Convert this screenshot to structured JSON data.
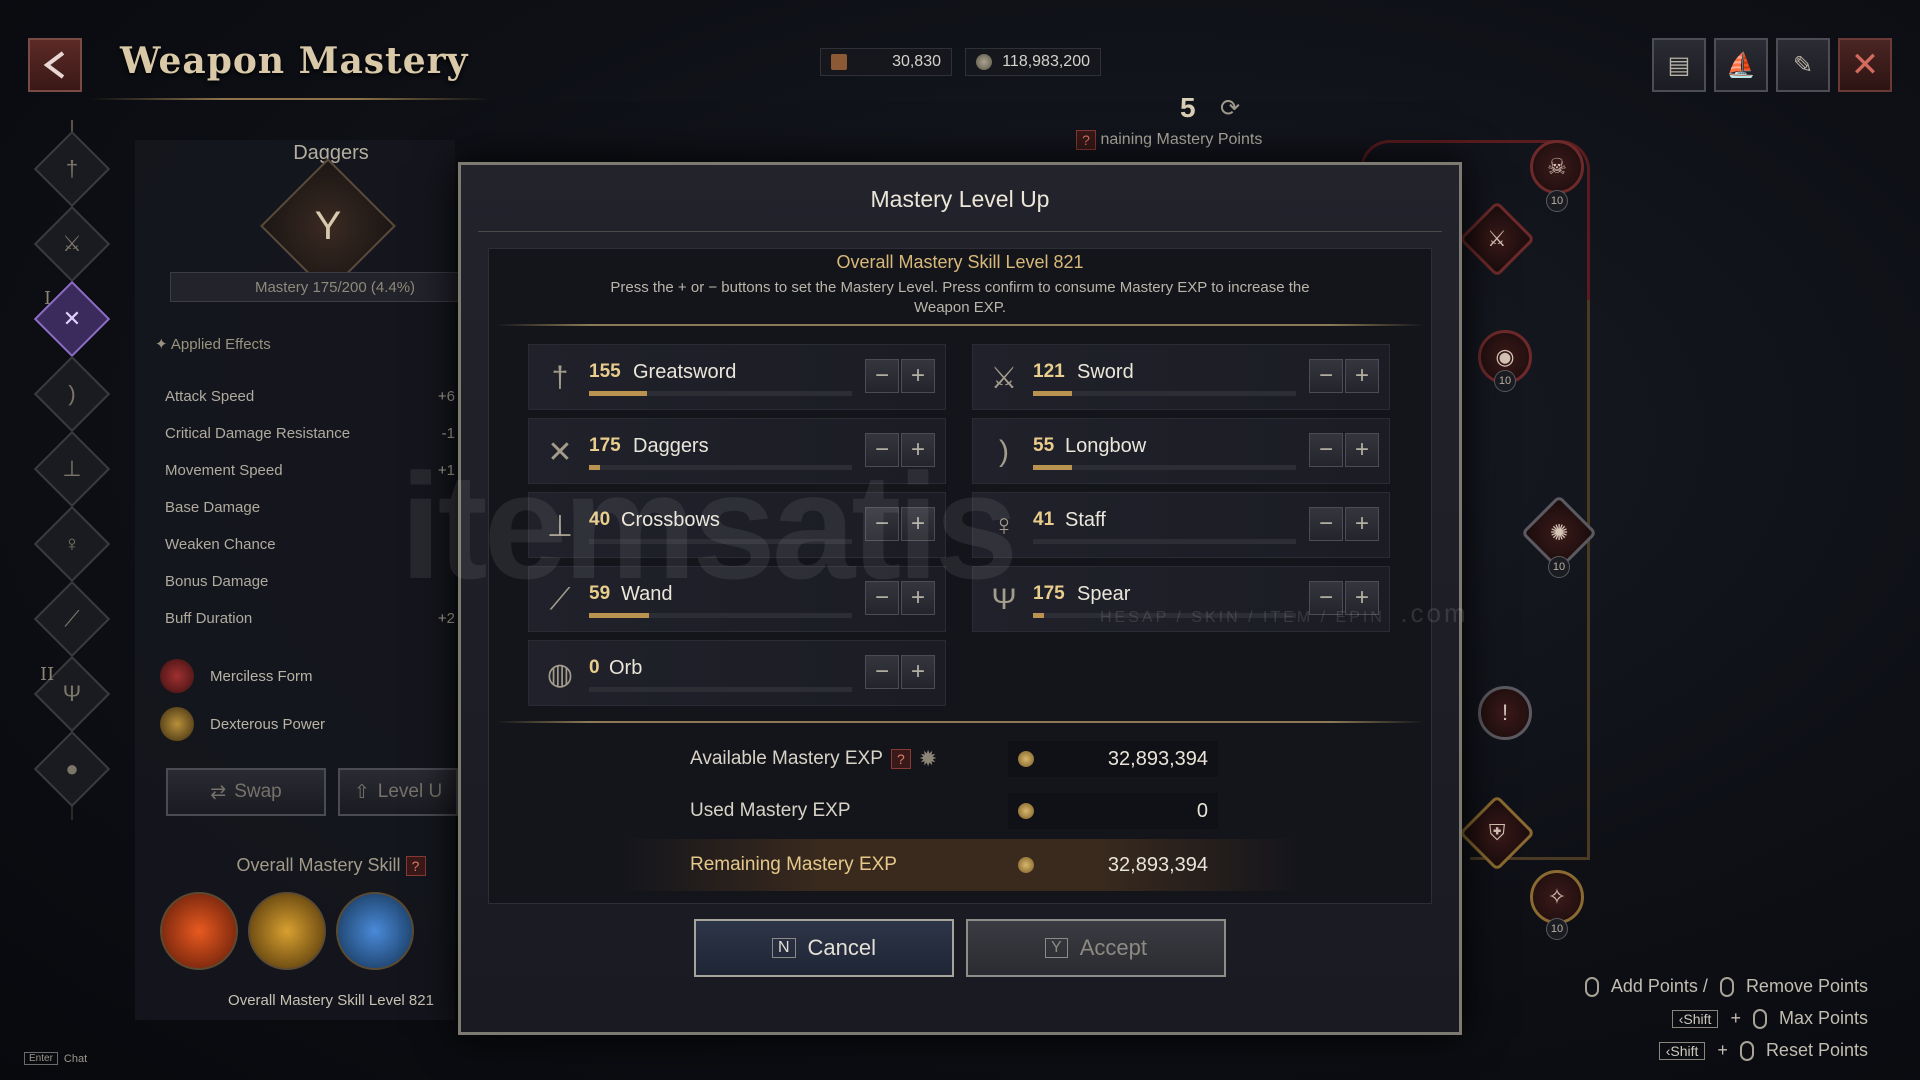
{
  "header": {
    "title": "Weapon Mastery",
    "currency_1": "30,830",
    "currency_2": "118,983,200",
    "points_count": "5",
    "points_label": "naining Mastery Points"
  },
  "left_panel": {
    "weapon_name": "Daggers",
    "mastery_progress_text": "Mastery 175/200 (4.4%)",
    "mastery_progress_fraction": 0.044,
    "applied_effects_label": "Applied Effects",
    "effects": [
      {
        "name": "Attack Speed",
        "value": "+6"
      },
      {
        "name": "Critical Damage Resistance",
        "value": "-1"
      },
      {
        "name": "Movement Speed",
        "value": "+1"
      },
      {
        "name": "Base Damage",
        "value": ""
      },
      {
        "name": "Weaken Chance",
        "value": ""
      },
      {
        "name": "Bonus Damage",
        "value": ""
      },
      {
        "name": "Buff Duration",
        "value": "+2"
      }
    ],
    "skills": [
      {
        "name": "Merciless Form"
      },
      {
        "name": "Dexterous Power"
      }
    ],
    "swap_label": "Swap",
    "levelup_label": "Level U",
    "overall_skill_label": "Overall Mastery Skill",
    "overall_skill_level": "Overall Mastery Skill Level 821",
    "roman_1": "I",
    "roman_2": "II"
  },
  "modal": {
    "title": "Mastery Level Up",
    "overall_title": "Overall Mastery Skill Level 821",
    "description": "Press the + or − buttons to set the Mastery Level. Press confirm to consume Mastery EXP to increase the Weapon EXP.",
    "weapons": [
      {
        "level": "155",
        "name": "Greatsword",
        "fill": 0.22,
        "icon": "greatsword-icon"
      },
      {
        "level": "121",
        "name": "Sword",
        "fill": 0.15,
        "icon": "sword-icon"
      },
      {
        "level": "175",
        "name": "Daggers",
        "fill": 0.04,
        "icon": "daggers-icon"
      },
      {
        "level": "55",
        "name": "Longbow",
        "fill": 0.15,
        "icon": "longbow-icon"
      },
      {
        "level": "40",
        "name": "Crossbows",
        "fill": 0.0,
        "icon": "crossbow-icon"
      },
      {
        "level": "41",
        "name": "Staff",
        "fill": 0.0,
        "icon": "staff-icon"
      },
      {
        "level": "59",
        "name": "Wand",
        "fill": 0.23,
        "icon": "wand-icon"
      },
      {
        "level": "175",
        "name": "Spear",
        "fill": 0.04,
        "icon": "spear-icon"
      },
      {
        "level": "0",
        "name": "Orb",
        "fill": 0.0,
        "icon": "orb-icon"
      }
    ],
    "available_label": "Available Mastery EXP",
    "available_value": "32,893,394",
    "used_label": "Used Mastery EXP",
    "used_value": "0",
    "remaining_label": "Remaining Mastery EXP",
    "remaining_value": "32,893,394",
    "cancel_key": "N",
    "cancel_label": "Cancel",
    "accept_key": "Y",
    "accept_label": "Accept"
  },
  "tree": {
    "node_levels": [
      "10",
      "10",
      "10",
      "10"
    ]
  },
  "hints": {
    "add_points": "Add Points /",
    "remove_points": "Remove Points",
    "shift_key": "Shift",
    "plus": "+",
    "max_points": "Max Points",
    "reset_points": "Reset Points"
  },
  "chat": {
    "key": "Enter",
    "label": "Chat"
  },
  "watermark": {
    "text": "itemsatis",
    "sub": "HESAP / SKIN / ITEM / EPIN",
    "com": ".com"
  },
  "colors": {
    "accent_gold": "#d9b97a",
    "progress_fill": "#b9934f",
    "danger_red": "#6e2a2a"
  }
}
